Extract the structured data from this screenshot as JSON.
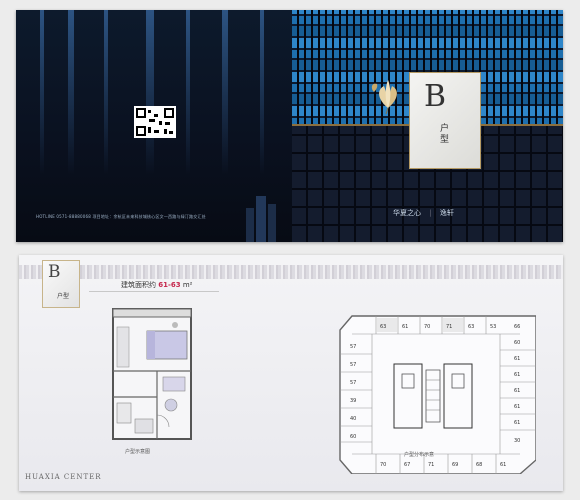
{
  "brochure": {
    "contact_text": "HOTLINE 0571-88880068  项目地址：余杭区未来科技城核心区文一西路与绿汀路交汇处",
    "card_letter": "B",
    "card_label": "户型",
    "brand_text": "华夏之心",
    "brand_sub": "逸轩"
  },
  "plan_page": {
    "tag_letter": "B",
    "tag_label": "户型",
    "area_prefix": "建筑面积约",
    "area_value": "61-63",
    "area_unit": "m²",
    "unit_caption": "户型示意图",
    "dist_caption": "户型分布示意",
    "footer_logo": "HUAXIA CENTER",
    "unit_areas_top": [
      "63",
      "61",
      "70",
      "71",
      "63",
      "53",
      "66"
    ],
    "unit_areas_left": [
      "57",
      "57",
      "57",
      "39",
      "40",
      "60"
    ],
    "unit_areas_right": [
      "60",
      "61",
      "61",
      "61",
      "61",
      "61",
      "30"
    ],
    "unit_areas_bottom": [
      "70",
      "67",
      "71",
      "69",
      "68",
      "61"
    ]
  },
  "colors": {
    "accent_red": "#c5274c",
    "gold": "#b59a63",
    "tile_blue": "#2e86c9"
  }
}
